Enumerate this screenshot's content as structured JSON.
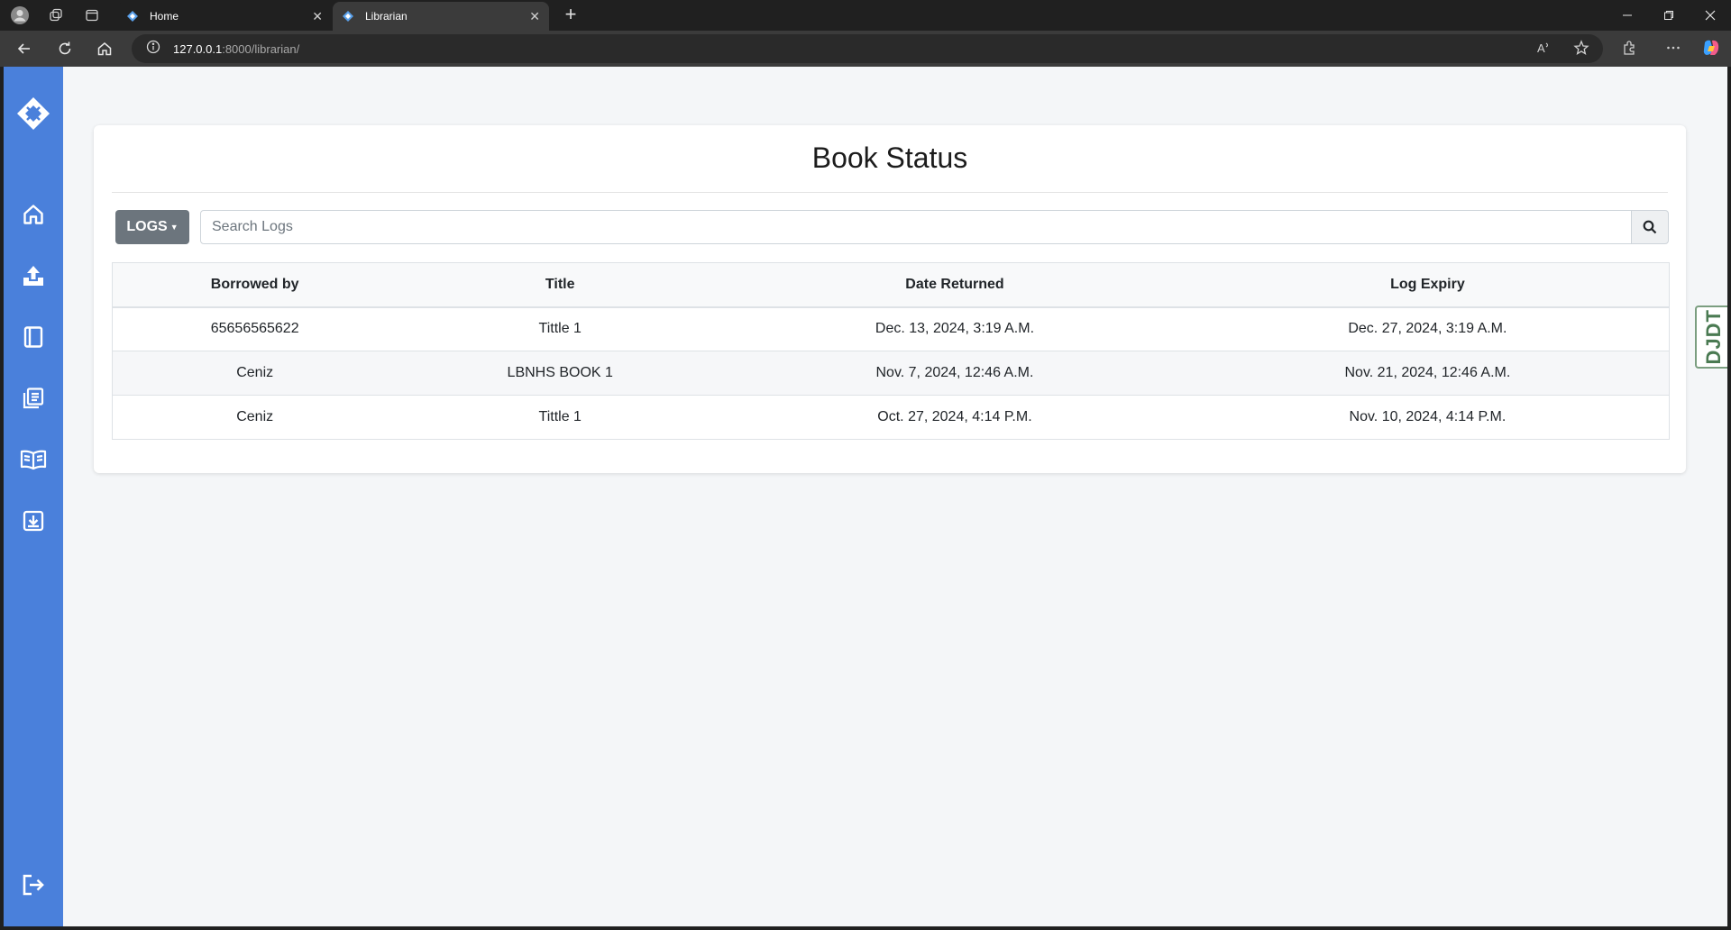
{
  "browser": {
    "tabs": [
      {
        "label": "Home",
        "active": false
      },
      {
        "label": "Librarian",
        "active": true
      }
    ],
    "url_host": "127.0.0.1",
    "url_path": ":8000/librarian/"
  },
  "page": {
    "title": "Book Status",
    "logs_button_label": "LOGS",
    "search_placeholder": "Search Logs",
    "table": {
      "headers": [
        "Borrowed by",
        "Title",
        "Date Returned",
        "Log Expiry"
      ],
      "rows": [
        [
          "65656565622",
          "Tittle 1",
          "Dec. 13, 2024, 3:19 A.M.",
          "Dec. 27, 2024, 3:19 A.M."
        ],
        [
          "Ceniz",
          "LBNHS BOOK 1",
          "Nov. 7, 2024, 12:46 A.M.",
          "Nov. 21, 2024, 12:46 A.M."
        ],
        [
          "Ceniz",
          "Tittle 1",
          "Oct. 27, 2024, 4:14 P.M.",
          "Nov. 10, 2024, 4:14 P.M."
        ]
      ]
    },
    "debug_toolbar_label": "DJDT"
  },
  "sidebar": {
    "icons": [
      "logo-icon",
      "home-icon",
      "upload-icon",
      "book-icon",
      "list-icon",
      "open-book-icon",
      "download-box-icon",
      "logout-icon"
    ]
  },
  "colors": {
    "sidebar": "#4a80db",
    "logs_button": "#6c757d",
    "page_background": "#f4f6f8"
  }
}
